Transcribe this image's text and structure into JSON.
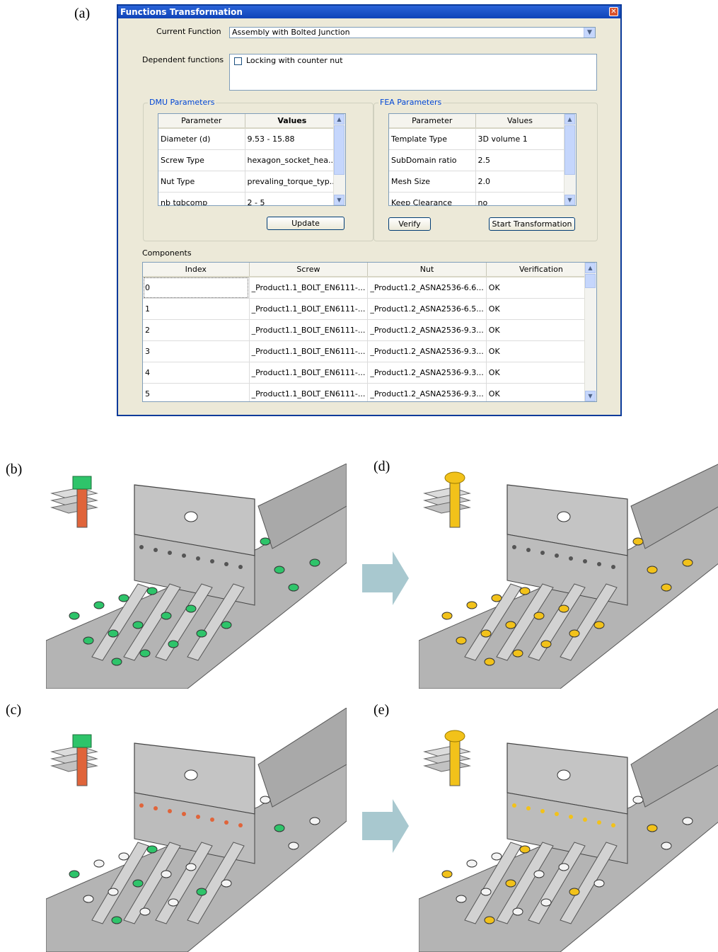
{
  "labels": {
    "a": "(a)",
    "b": "(b)",
    "c": "(c)",
    "d": "(d)",
    "e": "(e)"
  },
  "dialog": {
    "title": "Functions Transformation",
    "current_function_label": "Current Function",
    "current_function_value": "Assembly with Bolted Junction",
    "dependent_label": "Dependent functions",
    "dependent_items": [
      "Locking with counter nut"
    ],
    "dmu": {
      "title": "DMU Parameters",
      "headers": [
        "Parameter",
        "Values"
      ],
      "rows": [
        [
          "Diameter (d)",
          "9.53 - 15.88"
        ],
        [
          "Screw Type",
          "hexagon_socket_hea..."
        ],
        [
          "Nut Type",
          "prevaling_torque_typ..."
        ],
        [
          "nb tgbcomp",
          "2 - 5"
        ]
      ],
      "update_label": "Update"
    },
    "fea": {
      "title": "FEA Parameters",
      "headers": [
        "Parameter",
        "Values"
      ],
      "rows": [
        [
          "Template Type",
          "3D volume 1"
        ],
        [
          "SubDomain ratio",
          "2.5"
        ],
        [
          "Mesh Size",
          "2.0"
        ],
        [
          "Keep Clearance",
          "no"
        ]
      ],
      "verify_label": "Verify",
      "start_label": "Start Transformation"
    },
    "components": {
      "label": "Components",
      "headers": [
        "Index",
        "Screw",
        "Nut",
        "Verification"
      ],
      "rows": [
        [
          "0",
          "_Product1.1_BOLT_EN6111-...",
          "_Product1.2_ASNA2536-6.6...",
          "OK"
        ],
        [
          "1",
          "_Product1.1_BOLT_EN6111-...",
          "_Product1.2_ASNA2536-6.5...",
          "OK"
        ],
        [
          "2",
          "_Product1.1_BOLT_EN6111-...",
          "_Product1.2_ASNA2536-9.3...",
          "OK"
        ],
        [
          "3",
          "_Product1.1_BOLT_EN6111-...",
          "_Product1.2_ASNA2536-9.3...",
          "OK"
        ],
        [
          "4",
          "_Product1.1_BOLT_EN6111-...",
          "_Product1.2_ASNA2536-9.3...",
          "OK"
        ],
        [
          "5",
          "_Product1.1_BOLT_EN6111-...",
          "_Product1.2_ASNA2536-9.3...",
          "OK"
        ]
      ]
    }
  },
  "colors": {
    "titlebar": "#0f44b8",
    "dialog_bg": "#ece9d8",
    "nut_green": "#2ec46a",
    "screw_orange": "#e0643a",
    "fea_yellow": "#f2c21a",
    "arrow": "#a8c8cf",
    "metal": "#c8c8c8"
  },
  "panels": [
    {
      "id": "b",
      "icon": "bolt-with-nut-icon",
      "fastener": "green-nut"
    },
    {
      "id": "d",
      "icon": "fea-bolt-icon",
      "fastener": "yellow-head"
    },
    {
      "id": "c",
      "icon": "bolt-with-nut-icon",
      "fastener": "mixed-nut"
    },
    {
      "id": "e",
      "icon": "fea-bolt-icon",
      "fastener": "mixed-head"
    }
  ]
}
